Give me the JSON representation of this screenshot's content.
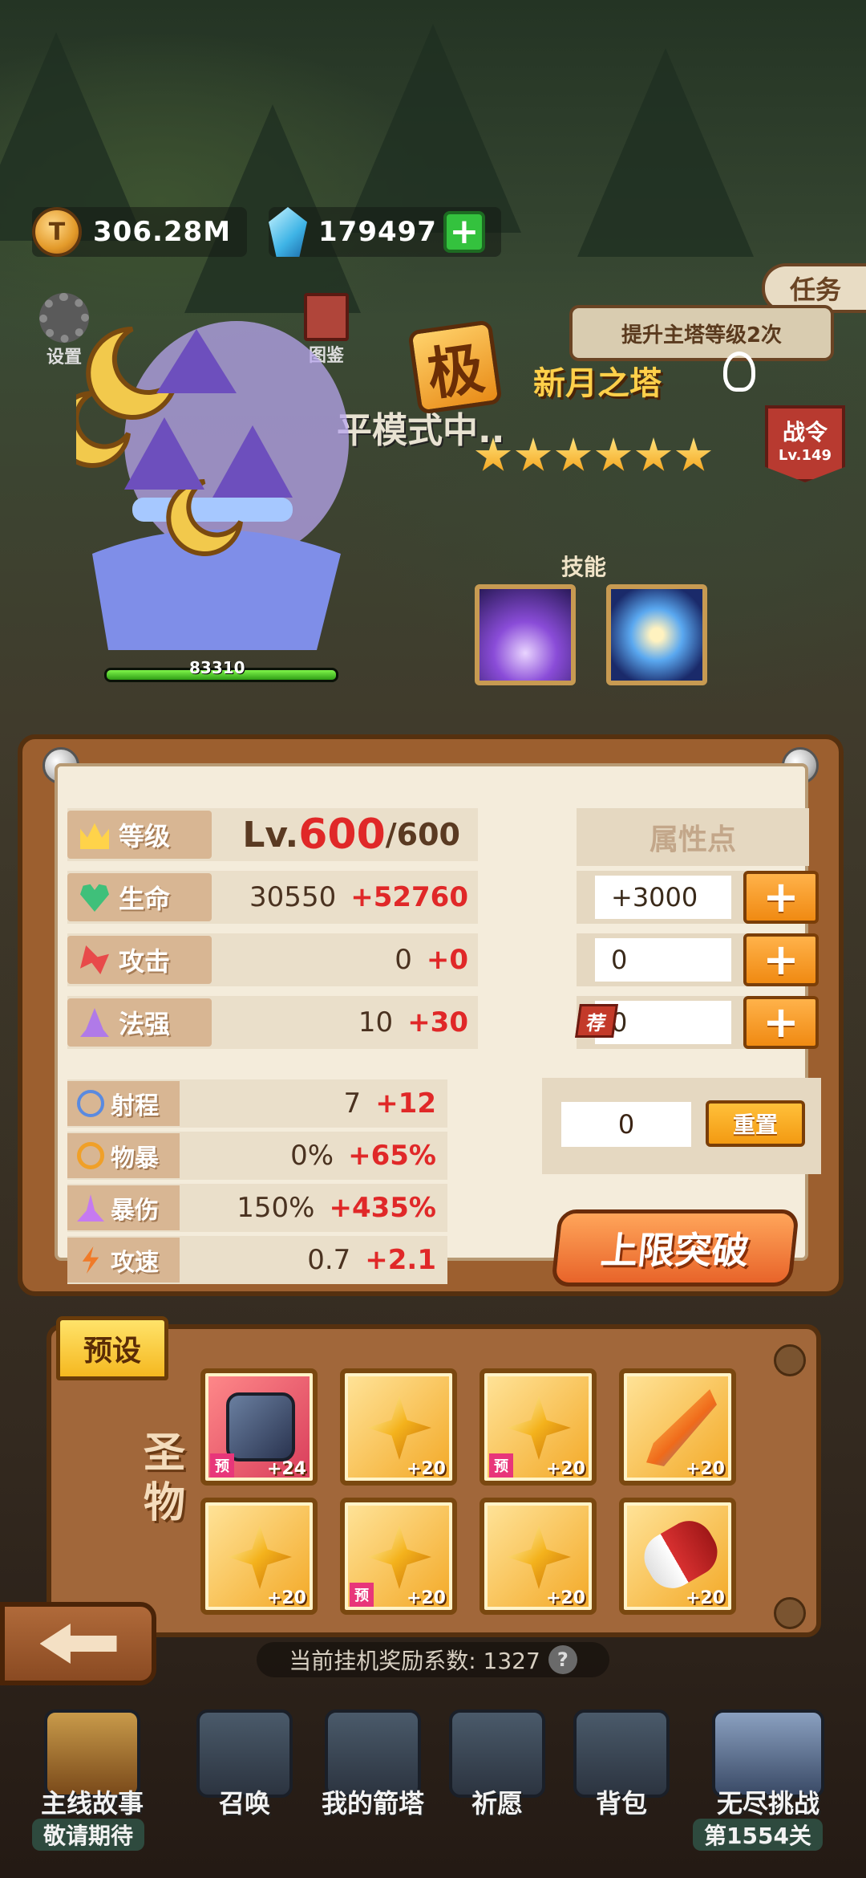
{
  "currency": {
    "gold": "306.28M",
    "gems": "179497"
  },
  "top_left": {
    "settings": "设置",
    "guide": "图鉴"
  },
  "quest": {
    "tab": "任务",
    "text": "提升主塔等级2次"
  },
  "battle_pass": {
    "title": "战令",
    "level": "Lv.149"
  },
  "bg_text": "平模式中..",
  "tower": {
    "grade": "极",
    "name": "新月之塔",
    "stars": 6,
    "hp": "83310",
    "hp_fraction": 1.0
  },
  "skills": {
    "label": "技能"
  },
  "stats": {
    "level": {
      "label": "等级",
      "prefix": "Lv.",
      "current": "600",
      "max": "/600"
    },
    "life": {
      "label": "生命",
      "base": "30550",
      "bonus": "+52760"
    },
    "attack": {
      "label": "攻击",
      "base": "0",
      "bonus": "+0"
    },
    "magic": {
      "label": "法强",
      "base": "10",
      "bonus": "+30"
    },
    "range": {
      "label": "射程",
      "base": "7",
      "bonus": "+12"
    },
    "crit": {
      "label": "物暴",
      "base": "0%",
      "bonus": "+65%"
    },
    "crit_dmg": {
      "label": "暴伤",
      "base": "150%",
      "bonus": "+435%"
    },
    "speed": {
      "label": "攻速",
      "base": "0.7",
      "bonus": "+2.1"
    }
  },
  "attribute_points": {
    "header": "属性点",
    "life_input": "+3000",
    "attack_input": "0",
    "magic_input": "0",
    "recommend": "荐",
    "plus": "+",
    "reset_value": "0",
    "reset_label": "重置"
  },
  "breakthrough": "上限突破",
  "relics": {
    "preset": "预设",
    "label": "圣物",
    "pre_tag": "预",
    "items": [
      "+24",
      "+20",
      "+20",
      "+20",
      "+20",
      "+20",
      "+20",
      "+20"
    ]
  },
  "idle": {
    "text": "当前挂机奖励系数: 1327",
    "help": "?"
  },
  "nav": {
    "story": "主线故事",
    "story_sub": "敬请期待",
    "summon": "召唤",
    "tower": "我的箭塔",
    "pray": "祈愿",
    "bag": "背包",
    "endless": "无尽挑战",
    "endless_sub": "第1554关"
  },
  "colors": {
    "accent_red": "#e02828",
    "button_orange": "#f08a12",
    "panel_brown": "#9c5f2f"
  }
}
